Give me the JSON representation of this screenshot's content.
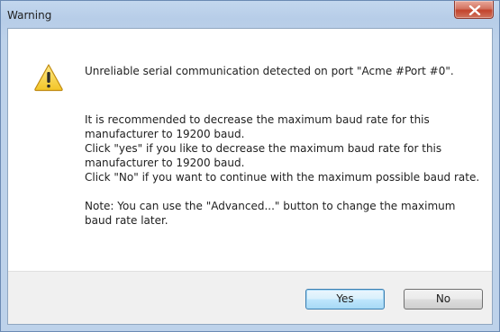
{
  "window": {
    "title": "Warning"
  },
  "icons": {
    "close": "close-icon",
    "warning": "warning-triangle-icon"
  },
  "message": {
    "headline": "Unreliable serial communication detected on port \"Acme #Port #0\".",
    "lines": [
      "It is recommended to decrease the maximum baud rate for this manufacturer to 19200 baud.",
      "Click \"yes\" if you like to decrease the maximum baud rate for this manufacturer to 19200 baud.",
      "Click \"No\" if you want to continue with the maximum possible baud rate."
    ],
    "note": "Note: You can use the \"Advanced...\" button to change the maximum baud rate later."
  },
  "buttons": {
    "yes": "Yes",
    "no": "No"
  },
  "colors": {
    "titlebar": "#bdd2ea",
    "close_button": "#c2432c",
    "footer": "#f0f0f0",
    "warning_yellow": "#f7d23e"
  }
}
